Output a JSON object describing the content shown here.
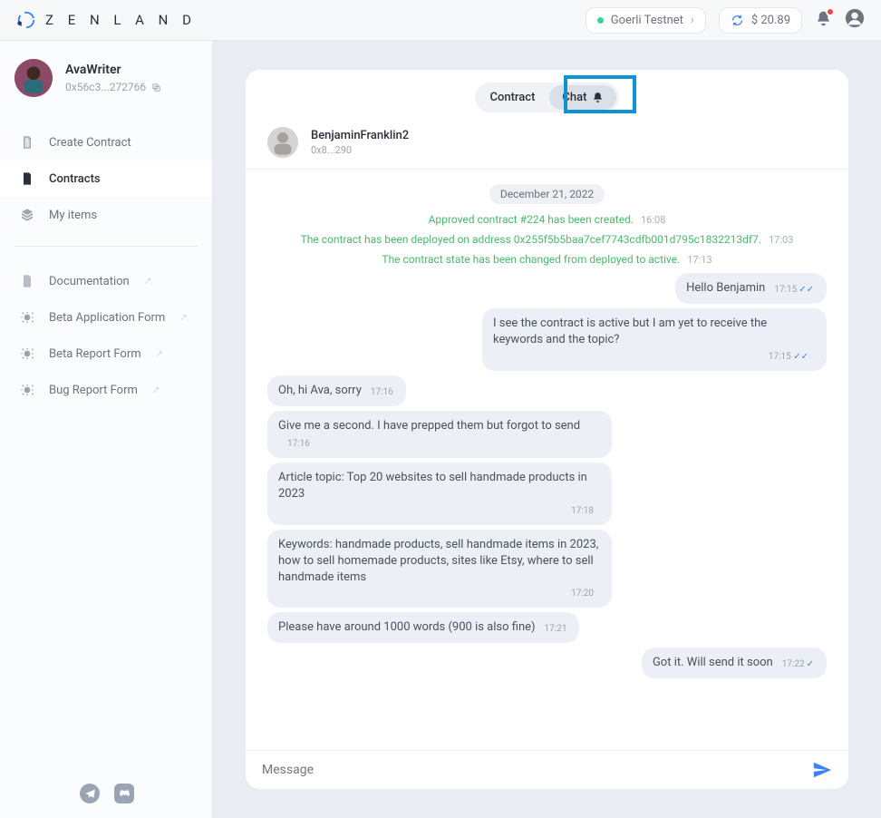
{
  "header": {
    "brand": "Z E N L A N D",
    "network": "Goerli Testnet",
    "balance": "$ 20.89"
  },
  "profile": {
    "name": "AvaWriter",
    "address": "0x56c3...272766"
  },
  "nav": {
    "create": "Create Contract",
    "contracts": "Contracts",
    "myitems": "My items",
    "doc": "Documentation",
    "beta_app": "Beta Application Form",
    "beta_report": "Beta Report Form",
    "bug_report": "Bug Report Form"
  },
  "tabs": {
    "contract": "Contract",
    "chat": "Chat"
  },
  "peer": {
    "name": "BenjaminFranklin2",
    "address": "0x8...290"
  },
  "chat": {
    "date": "December 21, 2022",
    "sys": [
      {
        "text": "Approved contract #224 has been created.",
        "time": "16:08"
      },
      {
        "text": "The contract has been deployed on address 0x255f5b5baa7cef7743cdfb001d795c1832213df7.",
        "time": "17:03"
      },
      {
        "text": "The contract state has been changed from deployed to active.",
        "time": "17:13"
      }
    ],
    "m": [
      {
        "side": "right",
        "text": "Hello Benjamin",
        "time": "17:15",
        "ticks": 2
      },
      {
        "side": "right",
        "text": "I see the contract is active but I am yet to receive the keywords and the topic?",
        "time": "17:15",
        "ticks": 2
      },
      {
        "side": "left",
        "text": "Oh, hi Ava, sorry",
        "time": "17:16"
      },
      {
        "side": "left",
        "text": "Give me a second. I have prepped them but forgot to send",
        "time": "17:16"
      },
      {
        "side": "left",
        "text": "Article topic: Top 20 websites to sell handmade products in 2023",
        "time": "17:18"
      },
      {
        "side": "left",
        "text": "Keywords: handmade products, sell handmade items in 2023, how to sell homemade products, sites like Etsy, where to sell handmade items",
        "time": "17:20"
      },
      {
        "side": "left",
        "text": "Please have around 1000 words (900 is also fine)",
        "time": "17:21"
      },
      {
        "side": "right",
        "text": "Got it. Will send it soon",
        "time": "17:22",
        "ticks": 1
      }
    ],
    "placeholder": "Message"
  }
}
